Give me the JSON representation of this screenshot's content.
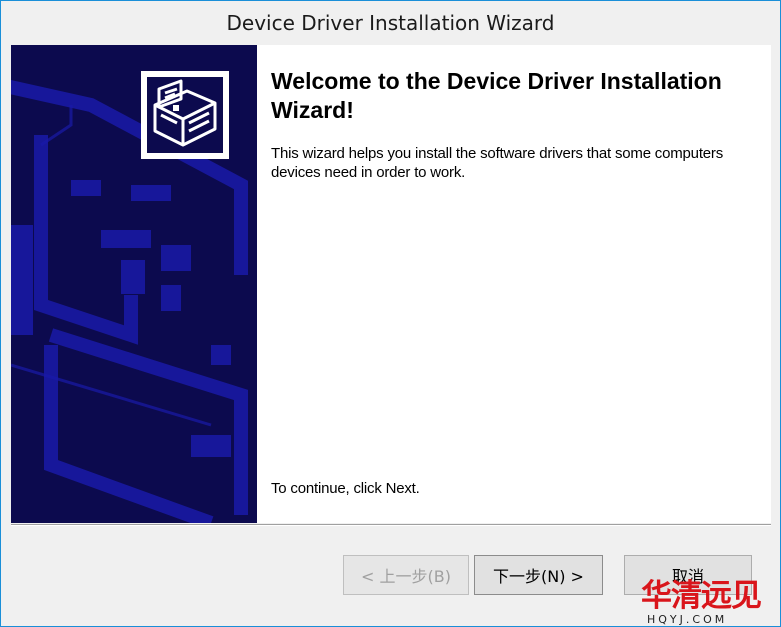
{
  "window": {
    "title": "Device Driver Installation Wizard"
  },
  "main": {
    "heading": "Welcome to the Device Driver Installation Wizard!",
    "description": "This wizard helps you install the software drivers that some computers devices need in order to work.",
    "continue_text": "To continue, click Next."
  },
  "buttons": {
    "back_label": "< 上一步(B)",
    "next_label": "下一步(N) >",
    "cancel_label": "取消"
  },
  "watermark": {
    "brand": "华清远见",
    "site": "HQYJ.COM"
  },
  "icons": {
    "wizard": "device-box-icon"
  },
  "colors": {
    "side_panel": "#0c0a4e",
    "side_pattern": "#1a1aa8",
    "window_border": "#1a8fd8",
    "watermark_red": "#d9151b"
  }
}
